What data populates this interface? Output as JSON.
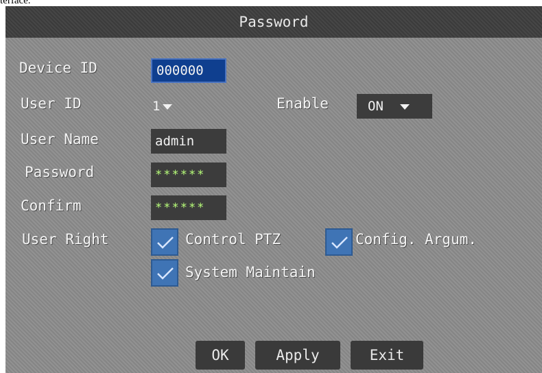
{
  "caption": "terface.",
  "window": {
    "title": "Password"
  },
  "device": {
    "label": "Device ID",
    "value": "000000"
  },
  "user": {
    "id_label": "User ID",
    "id_value": "1",
    "enable_label": "Enable",
    "enable_value": "ON",
    "name_label": "User Name",
    "name_value": "admin",
    "password_label": "Password",
    "password_value": "******",
    "confirm_label": "Confirm",
    "confirm_value": "******"
  },
  "rights": {
    "label": "User Right",
    "items": [
      {
        "label": "Control PTZ",
        "checked": true
      },
      {
        "label": "Config. Argum.",
        "checked": true
      },
      {
        "label": "System Maintain",
        "checked": true
      }
    ]
  },
  "buttons": {
    "ok": "OK",
    "apply": "Apply",
    "exit": "Exit"
  },
  "colors": {
    "panel": "#8c8c8c",
    "titlebar": "#3f3f3f",
    "checkbox": "#3f74b5",
    "selected_field": "#0f3f8f"
  }
}
